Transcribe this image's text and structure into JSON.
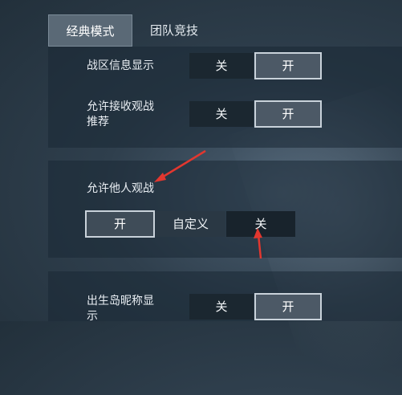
{
  "tabs": [
    {
      "label": "经典模式",
      "active": true
    },
    {
      "label": "团队竞技",
      "active": false
    }
  ],
  "settings": {
    "battle_info": {
      "label": "战区信息显示",
      "off": "关",
      "on": "开",
      "selected": "开"
    },
    "spectate_recommend": {
      "label_line1": "允许接收观战",
      "label_line2": "推荐",
      "off": "关",
      "on": "开",
      "selected": "开"
    },
    "allow_spectate": {
      "label": "允许他人观战",
      "options": [
        "开",
        "自定义",
        "关"
      ],
      "selected": "开"
    },
    "birth_island_name": {
      "label_line1": "出生岛昵称显",
      "label_line2": "示",
      "off": "关",
      "on": "开",
      "selected": "开"
    }
  },
  "colors": {
    "accent": "#e2372f",
    "selected_border": "#c9d2da",
    "segment_dark": "#1b2730"
  }
}
